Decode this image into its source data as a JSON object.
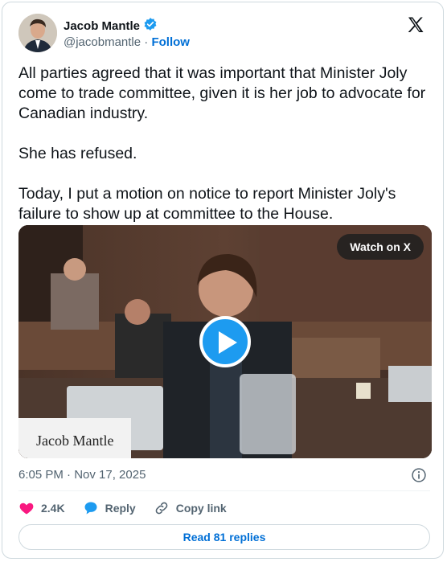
{
  "author": {
    "name": "Jacob Mantle",
    "handle": "@jacobmantle",
    "separator": "·",
    "follow_label": "Follow"
  },
  "tweet": {
    "text": "All parties agreed that it was important that Minister Joly come to trade committee, given it is her job to advocate for Canadian industry.\n\nShe has refused.\n\nToday, I put a motion on notice to report Minister Joly's failure to show up at committee to the House.",
    "timestamp": "6:05 PM · Nov 17, 2025"
  },
  "video": {
    "watch_label": "Watch on X",
    "nameplate_text": "Jacob Mantle"
  },
  "actions": {
    "likes": "2.4K",
    "reply_label": "Reply",
    "copy_link_label": "Copy link"
  },
  "read_replies_label": "Read 81 replies",
  "colors": {
    "accent": "#1d9bf0",
    "link": "#006fd6",
    "like": "#f91880",
    "muted": "#536471"
  }
}
